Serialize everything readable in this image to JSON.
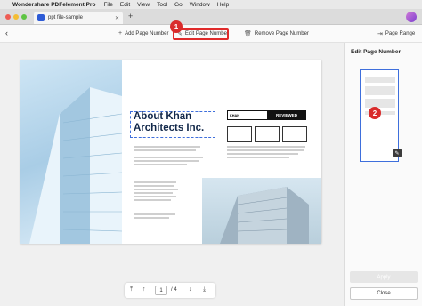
{
  "menubar": {
    "app_name": "Wondershare PDFelement Pro",
    "menus": [
      "File",
      "Edit",
      "View",
      "Tool",
      "Go",
      "Window",
      "Help"
    ]
  },
  "tab": {
    "title": "ppt file-sample",
    "close_glyph": "✕",
    "new_tab_glyph": "+"
  },
  "toolbar": {
    "add_label": "Add Page Number",
    "edit_label": "Edit Page Number",
    "remove_label": "Remove Page Number",
    "page_range_label": "Page Range"
  },
  "markers": {
    "one": "1",
    "two": "2"
  },
  "document": {
    "title_line1": "About Khan",
    "title_line2": "Architects Inc.",
    "brand": "KHAN",
    "badge": "REVIEWED"
  },
  "pager": {
    "current": "1",
    "total": "/ 4"
  },
  "side_panel": {
    "title": "Edit Page Number",
    "apply_label": "Apply",
    "close_label": "Close"
  },
  "colors": {
    "highlight": "#e02b2b",
    "selection": "#3e6fdc",
    "apply_disabled": "#e6e6e6"
  }
}
